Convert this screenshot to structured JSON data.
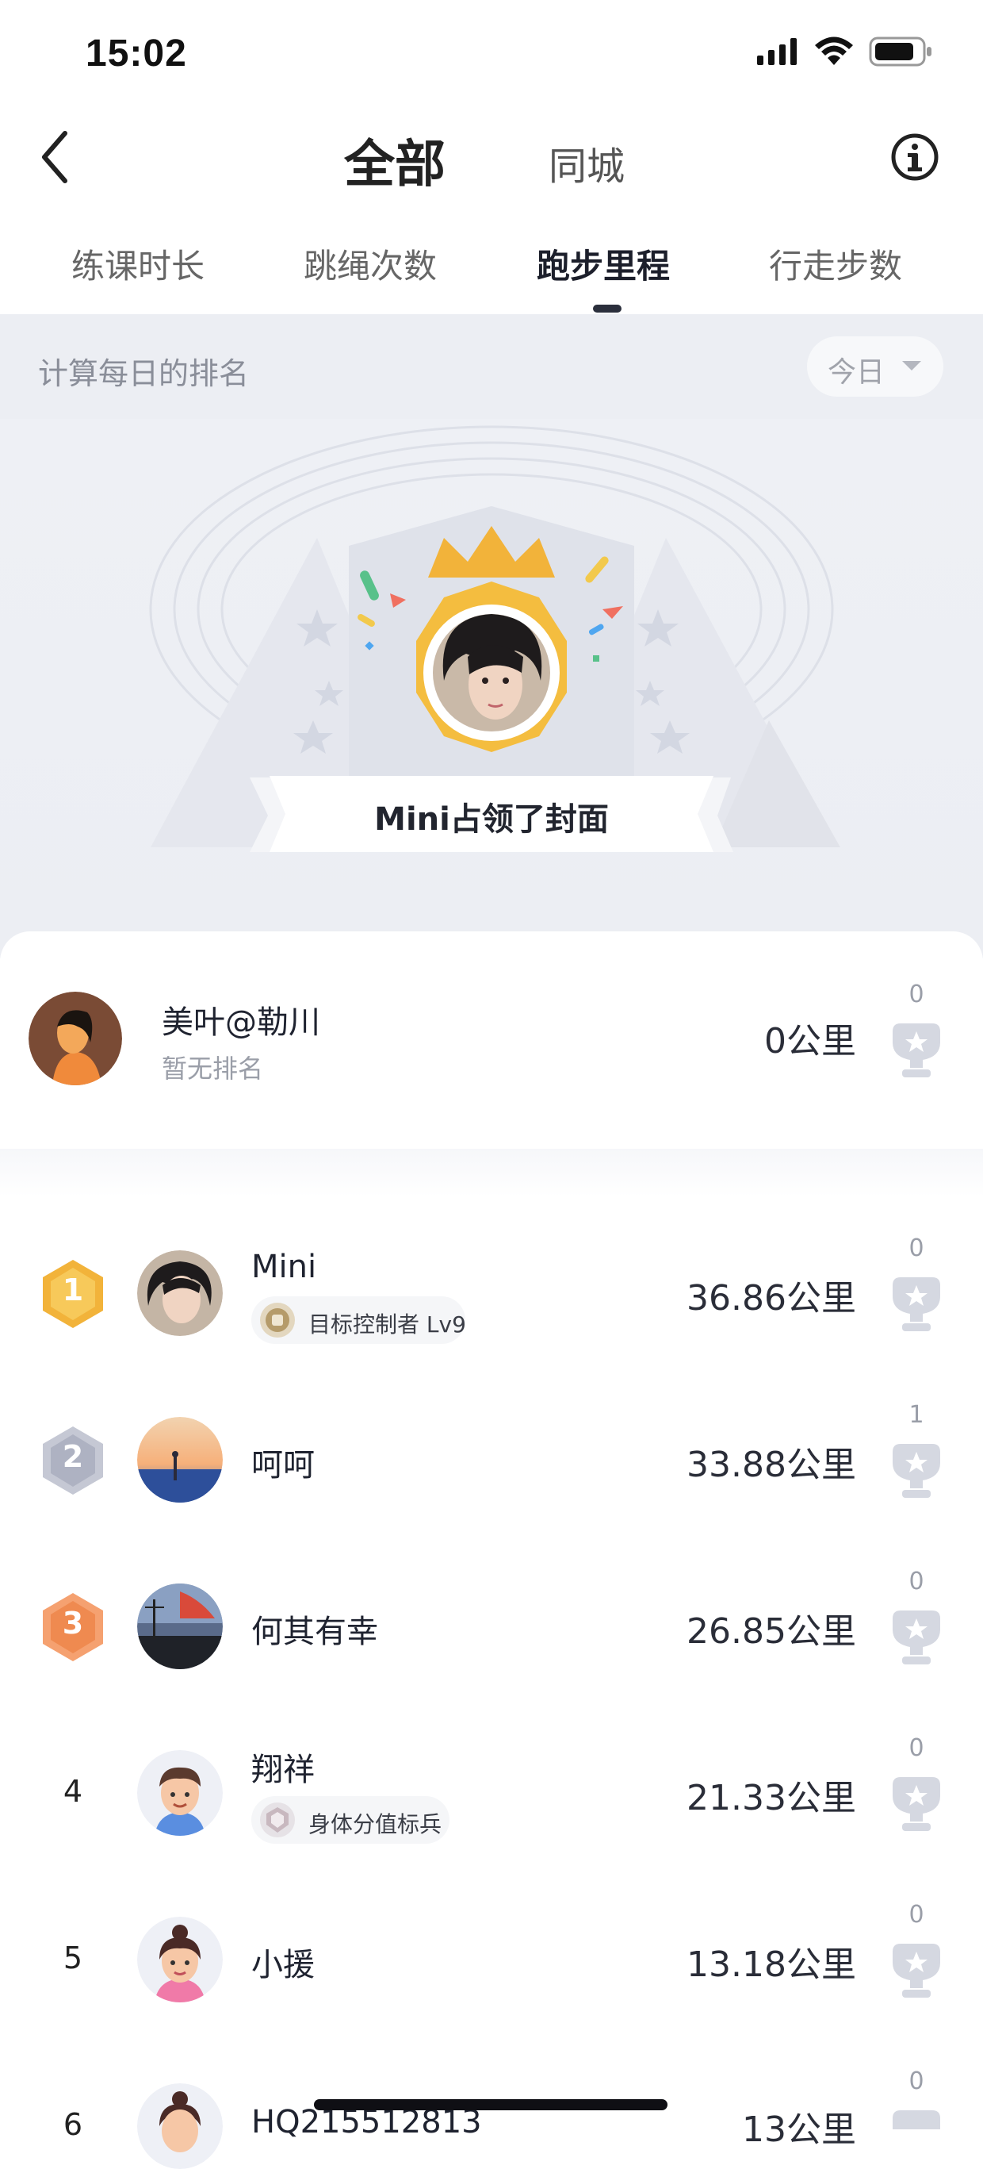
{
  "status_bar": {
    "time": "15:02"
  },
  "nav": {
    "title": "全部",
    "secondary": "同城"
  },
  "tabs": [
    {
      "label": "练课时长"
    },
    {
      "label": "跳绳次数"
    },
    {
      "label": "跑步里程"
    },
    {
      "label": "行走步数"
    }
  ],
  "filter": {
    "label": "计算每日的排名",
    "period": "今日"
  },
  "hero": {
    "cover_text": "Mini占领了封面"
  },
  "me": {
    "name": "美叶@勒川",
    "rank_text": "暂无排名",
    "distance": "0公里",
    "likes": "0"
  },
  "ranking": [
    {
      "rank": "1",
      "name": "Mini",
      "badge": "目标控制者 Lv9",
      "distance": "36.86公里",
      "likes": "0"
    },
    {
      "rank": "2",
      "name": "呵呵",
      "badge": "",
      "distance": "33.88公里",
      "likes": "1"
    },
    {
      "rank": "3",
      "name": "何其有幸",
      "badge": "",
      "distance": "26.85公里",
      "likes": "0"
    },
    {
      "rank": "4",
      "name": "翔祥",
      "badge": "身体分值标兵",
      "distance": "21.33公里",
      "likes": "0"
    },
    {
      "rank": "5",
      "name": "小援",
      "badge": "",
      "distance": "13.18公里",
      "likes": "0"
    },
    {
      "rank": "6",
      "name": "HQ215512813",
      "badge": "",
      "distance": "13公里",
      "likes": "0"
    }
  ],
  "colors": {
    "gold": "#f2b33a",
    "silver": "#b9bccb",
    "bronze": "#f08f56",
    "accent": "#2b2f3c"
  }
}
